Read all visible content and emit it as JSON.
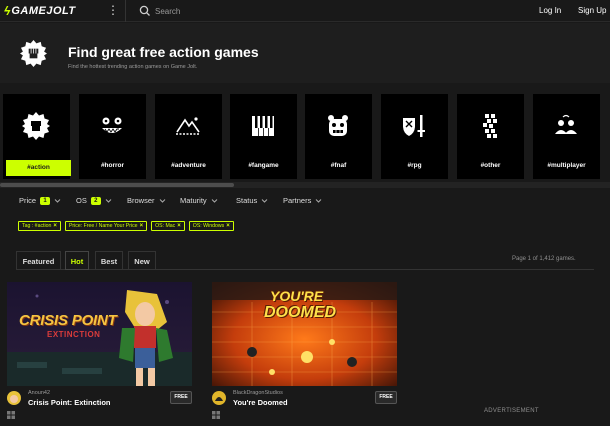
{
  "nav": {
    "logo_text": "GAMEJOLT",
    "search_placeholder": "Search",
    "login": "Log In",
    "signup": "Sign Up"
  },
  "header": {
    "title": "Find great free action games",
    "subtitle": "Find the hottest trending action games on Game Jolt."
  },
  "tags": [
    {
      "label": "#action",
      "icon": "fist-icon",
      "active": true
    },
    {
      "label": "#horror",
      "icon": "skull-face-icon",
      "active": false
    },
    {
      "label": "#adventure",
      "icon": "mountain-icon",
      "active": false
    },
    {
      "label": "#fangame",
      "icon": "piano-keys-icon",
      "active": false
    },
    {
      "label": "#fnaf",
      "icon": "bear-face-icon",
      "active": false
    },
    {
      "label": "#rpg",
      "icon": "shield-sword-icon",
      "active": false
    },
    {
      "label": "#other",
      "icon": "pixel-grid-icon",
      "active": false
    },
    {
      "label": "#multiplayer",
      "icon": "people-icon",
      "active": false
    }
  ],
  "filters": [
    {
      "label": "Price",
      "count": "1"
    },
    {
      "label": "OS",
      "count": "2"
    },
    {
      "label": "Browser",
      "count": ""
    },
    {
      "label": "Maturity",
      "count": ""
    },
    {
      "label": "Status",
      "count": ""
    },
    {
      "label": "Partners",
      "count": ""
    }
  ],
  "active_filters": [
    "Tag : #action",
    "Price: Free / Name Your Price",
    "OS: Mac",
    "OS: Windows"
  ],
  "sort_tabs": [
    {
      "label": "Featured",
      "active": false
    },
    {
      "label": "Hot",
      "active": true
    },
    {
      "label": "Best",
      "active": false
    },
    {
      "label": "New",
      "active": false
    }
  ],
  "page_info": "Page 1 of 1,412 games.",
  "games": [
    {
      "developer": "Anoun42",
      "title": "Crisis Point: Extinction",
      "price": "FREE",
      "thumb_title_line1": "CRISIS POINT",
      "thumb_title_line2": "EXTINCTION"
    },
    {
      "developer": "BlackDragonStudios",
      "title": "You're Doomed",
      "price": "FREE",
      "thumb_title_line1": "YOU'RE",
      "thumb_title_line2": "DOOMED"
    }
  ],
  "advertisement_label": "ADVERTISEMENT",
  "colors": {
    "accent": "#ccff00",
    "background": "#191919",
    "tile": "#000000"
  }
}
